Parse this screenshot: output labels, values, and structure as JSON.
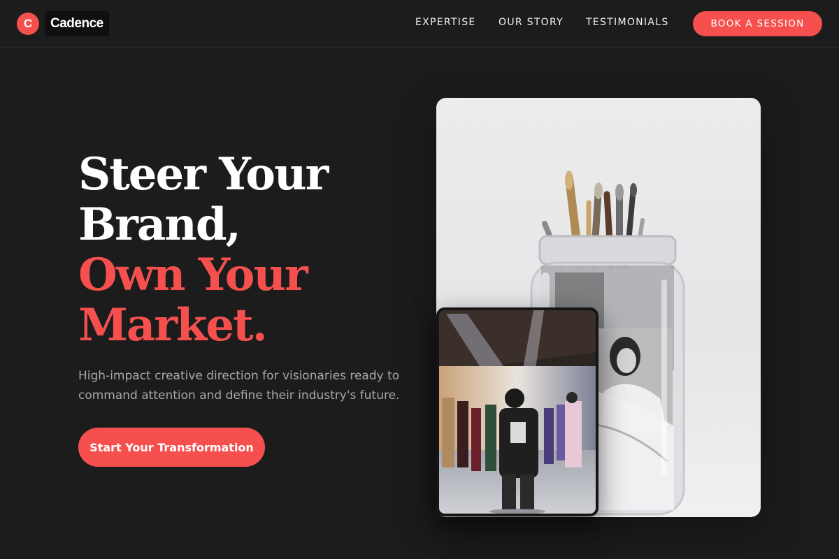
{
  "brand": {
    "logo_letter": "C",
    "name": "Cadence",
    "accent_color": "#f5504e",
    "background_color": "#1c1c1d"
  },
  "nav": {
    "items": [
      {
        "label": "EXPERTISE"
      },
      {
        "label": "OUR STORY"
      },
      {
        "label": "TESTIMONIALS"
      }
    ],
    "cta_label": "BOOK A SESSION"
  },
  "hero": {
    "headline_lines": [
      "Steer Your",
      "Brand,"
    ],
    "headline_accent_lines": [
      "Own Your",
      "Market."
    ],
    "subtext": "High-impact creative direction for visionaries ready to command attention and define their industry's future.",
    "cta_label": "Start Your Transformation"
  },
  "images": {
    "main_icon": "paintbrush-jar-photo",
    "inset_icon": "fashion-show-photo"
  }
}
